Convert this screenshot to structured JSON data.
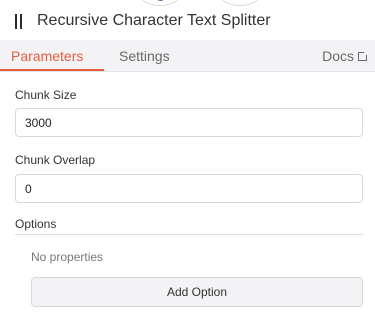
{
  "header": {
    "title": "Recursive Character Text Splitter"
  },
  "tabs": [
    {
      "label": "Parameters",
      "active": true
    },
    {
      "label": "Settings",
      "active": false
    }
  ],
  "docs": {
    "label": "Docs",
    "icon": "external-link-icon"
  },
  "parameters": {
    "chunk_size": {
      "label": "Chunk Size",
      "value": "3000"
    },
    "chunk_overlap": {
      "label": "Chunk Overlap",
      "value": "0"
    },
    "options": {
      "label": "Options",
      "empty_text": "No properties",
      "add_button": "Add Option"
    }
  },
  "colors": {
    "accent": "#e85d3f",
    "tab_bar": "#f3f3f5"
  }
}
